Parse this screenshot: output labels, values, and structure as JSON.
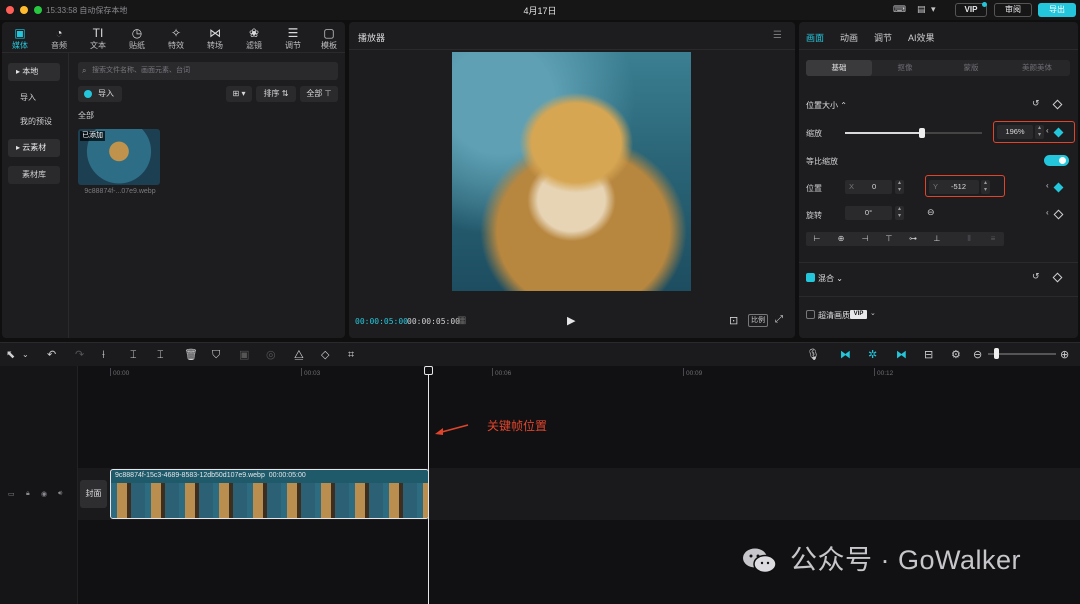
{
  "titlebar": {
    "save_status": "15:33:58 自动保存本地",
    "title": "4月17日",
    "vip": "VIP",
    "review": "审阅",
    "export": "导出"
  },
  "media": {
    "tabs": [
      {
        "icon": "media-icon",
        "label": "媒体"
      },
      {
        "icon": "audio-icon",
        "label": "音频"
      },
      {
        "icon": "text-icon",
        "label": "文本"
      },
      {
        "icon": "sticker-icon",
        "label": "贴纸"
      },
      {
        "icon": "effects-icon",
        "label": "特效"
      },
      {
        "icon": "transition-icon",
        "label": "转场"
      },
      {
        "icon": "filter-icon",
        "label": "滤镜"
      },
      {
        "icon": "adjust-icon",
        "label": "调节"
      },
      {
        "icon": "template-icon",
        "label": "模板"
      }
    ],
    "sidebar": [
      "本地",
      "导入",
      "我的预设",
      "云素材",
      "素材库"
    ],
    "search_placeholder": "搜索文件名称、画面元素、台词",
    "import": "导入",
    "sort": "排序",
    "all_filter": "全部",
    "all_label": "全部",
    "thumb_badge": "已添加",
    "file_name": "9c88874f-...07e9.webp"
  },
  "player": {
    "title": "播放器",
    "current_time": "00:00:05:00",
    "total_time": "00:00:05:00",
    "ratio": "比例"
  },
  "properties": {
    "tabs": [
      "画面",
      "动画",
      "调节",
      "AI效果"
    ],
    "segments": [
      "基础",
      "抠像",
      "蒙版",
      "美颜美体"
    ],
    "position_size": "位置大小",
    "scale_label": "缩放",
    "scale_value": "196%",
    "scale_percent": 0.56,
    "uniform_scale": "等比缩放",
    "position_label": "位置",
    "x_label": "X",
    "x_value": "0",
    "y_label": "Y",
    "y_value": "-512",
    "rotation_label": "旋转",
    "rotation_value": "0°",
    "blend": "混合",
    "super_res": "超清画质",
    "vip_tag": "VIP"
  },
  "timeline": {
    "ticks": [
      "00:00",
      "00:03",
      "00:06",
      "00:09",
      "00:12"
    ],
    "cover": "封面",
    "clip_name": "9c88874f-15c3-4689-8583-12db50d107e9.webp",
    "clip_duration": "00:00:05:00",
    "annotation": "关键帧位置"
  },
  "watermark": "公众号 · GoWalker",
  "colors": {
    "accent": "#24c6dc",
    "highlight": "#e0452c"
  }
}
